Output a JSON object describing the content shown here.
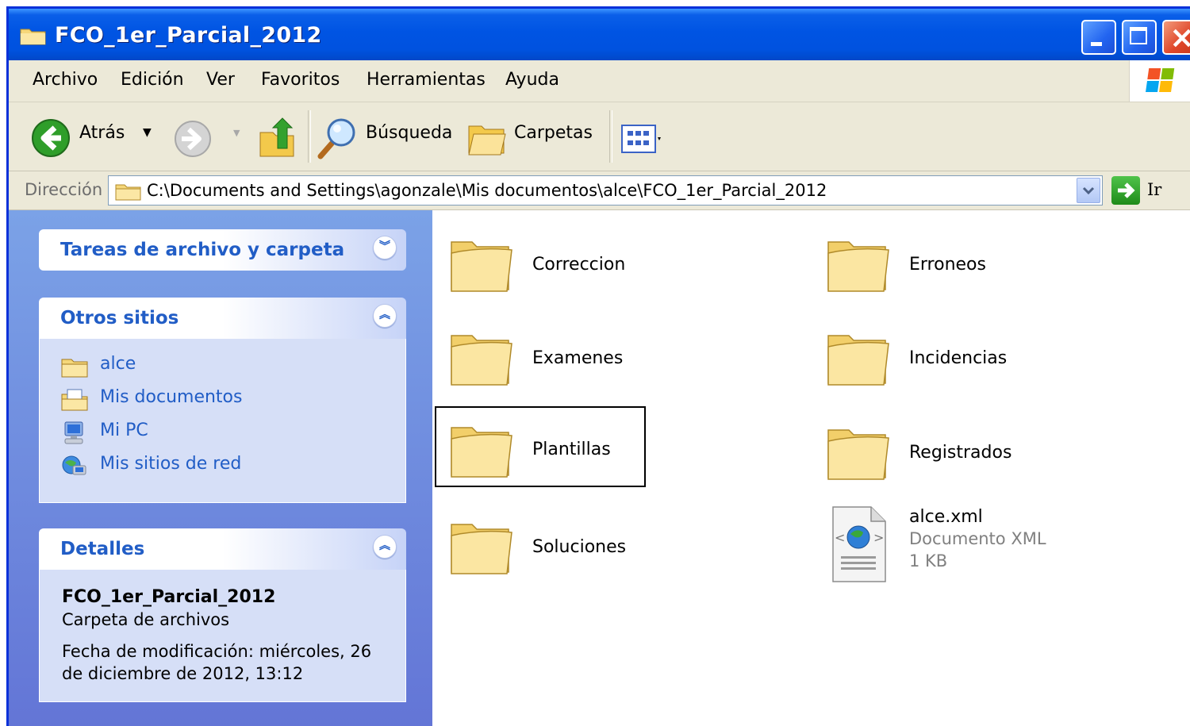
{
  "window": {
    "title": "FCO_1er_Parcial_2012"
  },
  "menu": [
    "Archivo",
    "Edición",
    "Ver",
    "Favoritos",
    "Herramientas",
    "Ayuda"
  ],
  "toolbar": {
    "back": "Atrás",
    "search": "Búsqueda",
    "folders": "Carpetas"
  },
  "address": {
    "label": "Dirección",
    "path": "C:\\Documents and Settings\\agonzale\\Mis documentos\\alce\\FCO_1er_Parcial_2012",
    "go": "Ir"
  },
  "taskpane": {
    "file_tasks": {
      "title": "Tareas de archivo y carpeta"
    },
    "other_places": {
      "title": "Otros sitios",
      "links": [
        {
          "label": "alce",
          "icon": "folder-icon"
        },
        {
          "label": "Mis documentos",
          "icon": "my-documents-icon"
        },
        {
          "label": "Mi PC",
          "icon": "my-computer-icon"
        },
        {
          "label": "Mis sitios de red",
          "icon": "network-places-icon"
        }
      ]
    },
    "details": {
      "title": "Detalles",
      "name": "FCO_1er_Parcial_2012",
      "type": "Carpeta de archivos",
      "modified": "Fecha de modificación: miércoles, 26 de diciembre de 2012, 13:12"
    }
  },
  "files": [
    {
      "name": "Correccion",
      "kind": "folder"
    },
    {
      "name": "Erroneos",
      "kind": "folder"
    },
    {
      "name": "Examenes",
      "kind": "folder"
    },
    {
      "name": "Incidencias",
      "kind": "folder"
    },
    {
      "name": "Plantillas",
      "kind": "folder",
      "selected": true
    },
    {
      "name": "Registrados",
      "kind": "folder"
    },
    {
      "name": "Soluciones",
      "kind": "folder"
    },
    {
      "name": "alce.xml",
      "kind": "xml",
      "type": "Documento XML",
      "size": "1 KB"
    }
  ]
}
